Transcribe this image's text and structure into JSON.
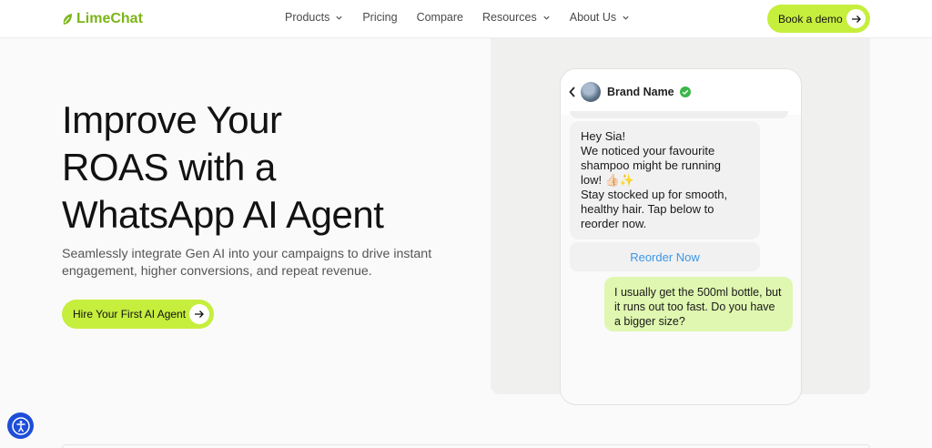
{
  "nav": {
    "logo_text": "LimeChat",
    "links": [
      {
        "label": "Products",
        "dropdown": true
      },
      {
        "label": "Pricing",
        "dropdown": false
      },
      {
        "label": "Compare",
        "dropdown": false
      },
      {
        "label": "Resources",
        "dropdown": true
      },
      {
        "label": "About Us",
        "dropdown": true
      }
    ],
    "demo_label": "Book a demo"
  },
  "hero": {
    "title_lines": [
      "Improve Your",
      "ROAS with a",
      "WhatsApp AI Agent"
    ],
    "subtitle": "Seamlessly integrate Gen AI into your campaigns to drive instant engagement, higher conversions, and repeat revenue.",
    "cta_label": "Hire Your First AI Agent"
  },
  "chat": {
    "brand_name": "Brand Name",
    "incoming_lines": [
      "Hey Sia!",
      "We noticed your favourite",
      "shampoo might be running",
      "low! 👍🏻✨",
      "Stay stocked up for smooth,",
      "healthy hair. Tap below to",
      "reorder now."
    ],
    "reorder_label": "Reorder Now",
    "outgoing_text": "I usually get the 500ml bottle, but it runs out too fast. Do you have a bigger size?"
  },
  "colors": {
    "accent_lime": "#c6ee3d",
    "logo_green": "#7cb518",
    "link_blue": "#3b96e8",
    "outgoing_bubble": "#dff7b0",
    "a11y_blue": "#1d4ed8"
  },
  "icons": {
    "logo": "leaf-icon",
    "dropdown": "chevron-down-icon",
    "arrow": "arrow-right-icon",
    "back": "chevron-left-icon",
    "verified": "verified-check-icon",
    "accessibility": "accessibility-icon"
  }
}
